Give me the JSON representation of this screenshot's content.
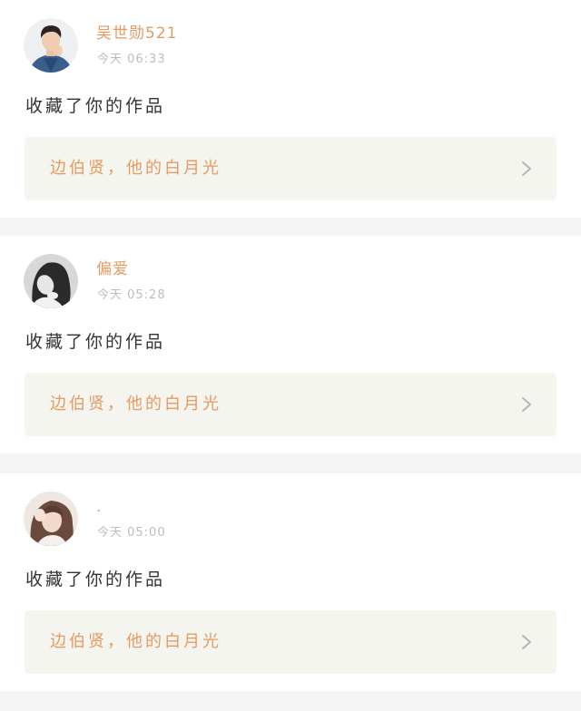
{
  "notifications": [
    {
      "username": "吴世勋521",
      "time": "今天 06:33",
      "action": "收藏了你的作品",
      "work_title": "边伯贤，他的白月光",
      "avatar_icon": "user-avatar-man-denim"
    },
    {
      "username": "偏爱",
      "time": "今天 05:28",
      "action": "收藏了你的作品",
      "work_title": "边伯贤，他的白月光",
      "avatar_icon": "user-avatar-girl-bw"
    },
    {
      "username": ".",
      "time": "今天 05:00",
      "action": "收藏了你的作品",
      "work_title": "边伯贤，他的白月光",
      "avatar_icon": "user-avatar-girl-brown-hair"
    }
  ],
  "colors": {
    "accent": "#e59a62",
    "muted": "#bdbdbd",
    "text": "#333333",
    "card_background": "#ffffff",
    "link_background": "#f5f5f0",
    "page_background": "#f5f5f5"
  }
}
